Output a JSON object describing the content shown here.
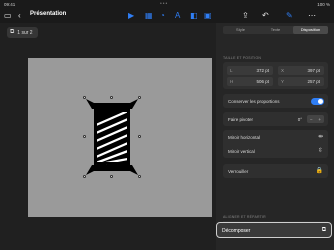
{
  "status": {
    "time": "09:41",
    "dots": "•••",
    "right": "100 %"
  },
  "toolbar": {
    "title": "Présentation",
    "icons": [
      "sidebar-icon",
      "back-chevron-icon",
      "play-icon",
      "table-icon",
      "chart-icon",
      "text-icon",
      "shape-icon",
      "media-icon",
      "share-icon",
      "undo-icon",
      "format-brush-icon",
      "more-icon"
    ]
  },
  "slide_indicator": {
    "label": "1 sur 2"
  },
  "panel": {
    "tabs": [
      "Style",
      "Texte",
      "Disposition"
    ],
    "active_tab": "Disposition",
    "size_section": "TAILLE ET POSITION",
    "fields": {
      "width": {
        "label": "L",
        "value": "372 pt"
      },
      "x": {
        "label": "X",
        "value": "397 pt"
      },
      "height": {
        "label": "H",
        "value": "506 pt"
      },
      "y": {
        "label": "Y",
        "value": "257 pt"
      }
    },
    "keep_ratio": "Conserver les proportions",
    "rotate": "Faire pivoter",
    "rotate_value": "0°",
    "flip_h": "Miroir horizontal",
    "flip_v": "Miroir vertical",
    "lock": "Verrouiller",
    "align_section": "ALIGNER ET RÉPARTIR",
    "decompose": "Décomposer"
  },
  "colors": {
    "accent": "#2f7ef5",
    "panel": "#262626",
    "slide": "#9a9a9a"
  }
}
